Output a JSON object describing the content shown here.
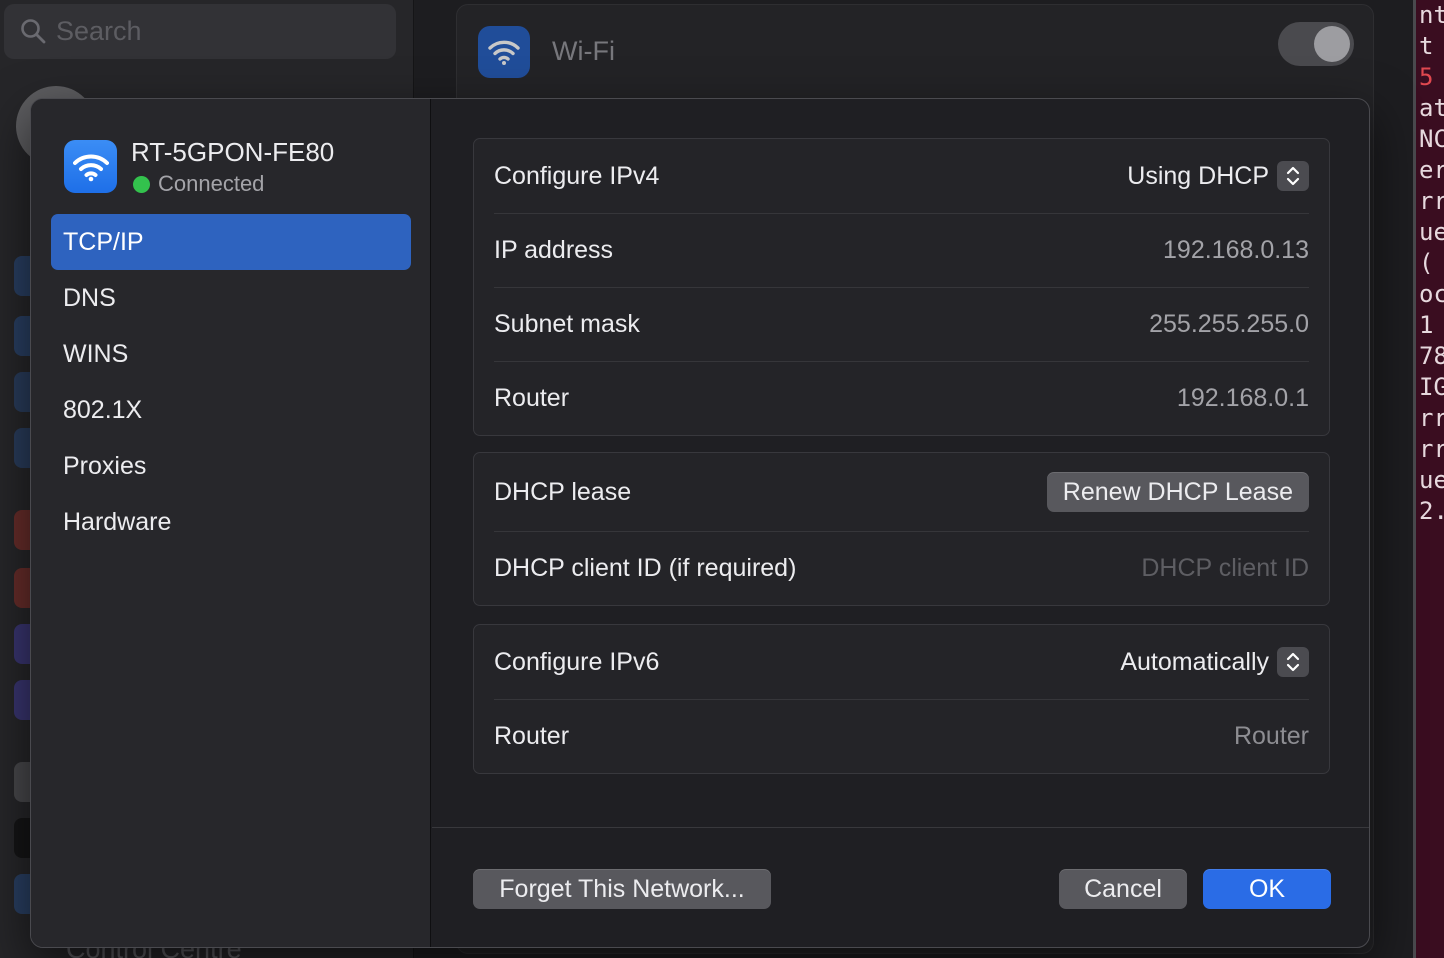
{
  "background": {
    "search_placeholder": "Search",
    "wifi_label": "Wi-Fi",
    "sidebar_bottom_label": "Control Centre",
    "terminal_lines": [
      "nt",
      "t",
      "5",
      "at",
      "NC",
      "er",
      "rr",
      "ue",
      "(",
      "",
      "oc",
      "1",
      "78",
      "IG",
      "rr",
      "rr",
      "ue",
      "2."
    ]
  },
  "network": {
    "name": "RT-5GPON-FE80",
    "status": "Connected",
    "status_color": "#33c24d"
  },
  "sidebar": {
    "items": [
      {
        "label": "TCP/IP",
        "selected": true
      },
      {
        "label": "DNS"
      },
      {
        "label": "WINS"
      },
      {
        "label": "802.1X"
      },
      {
        "label": "Proxies"
      },
      {
        "label": "Hardware"
      }
    ]
  },
  "ipv4": {
    "configure_label": "Configure IPv4",
    "configure_value": "Using DHCP",
    "ip_label": "IP address",
    "ip_value": "192.168.0.13",
    "subnet_label": "Subnet mask",
    "subnet_value": "255.255.255.0",
    "router_label": "Router",
    "router_value": "192.168.0.1"
  },
  "dhcp": {
    "lease_label": "DHCP lease",
    "renew_button": "Renew DHCP Lease",
    "client_id_label": "DHCP client ID (if required)",
    "client_id_placeholder": "DHCP client ID"
  },
  "ipv6": {
    "configure_label": "Configure IPv6",
    "configure_value": "Automatically",
    "router_label": "Router",
    "router_placeholder": "Router"
  },
  "footer": {
    "forget_button": "Forget This Network...",
    "cancel_button": "Cancel",
    "ok_button": "OK"
  },
  "colors": {
    "accent": "#2e63bf",
    "ok_button": "#2a6ce6"
  }
}
